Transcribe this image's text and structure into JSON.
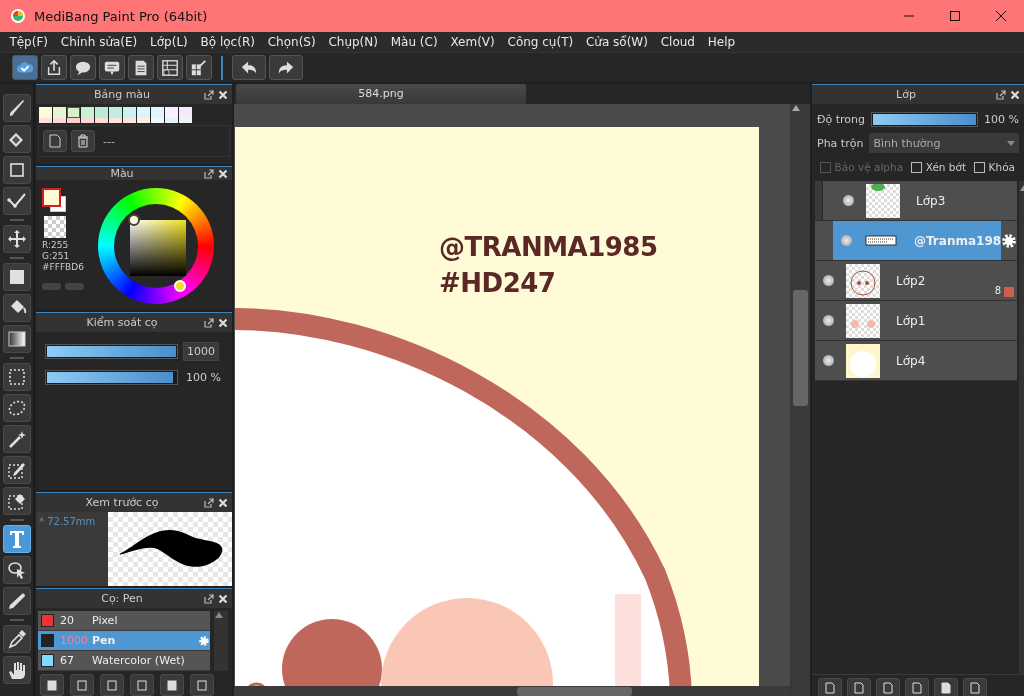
{
  "window": {
    "title": "MediBang Paint Pro (64bit)"
  },
  "menu": [
    "Tệp(F)",
    "Chỉnh sửa(E)",
    "Lớp(L)",
    "Bộ lọc(R)",
    "Chọn(S)",
    "Chụp(N)",
    "Màu (C)",
    "Xem(V)",
    "Công cụ(T)",
    "Cửa sổ(W)",
    "Cloud",
    "Help"
  ],
  "tool_groups": [
    [
      {
        "kind": "brush",
        "selected": false
      },
      {
        "kind": "eraser",
        "selected": false
      },
      {
        "kind": "square",
        "selected": false
      },
      {
        "kind": "polyline",
        "selected": false
      }
    ],
    [
      {
        "kind": "move",
        "selected": false
      }
    ],
    [
      {
        "kind": "fill",
        "selected": false
      },
      {
        "kind": "bucket",
        "selected": false
      },
      {
        "kind": "gradient",
        "selected": false
      }
    ],
    [
      {
        "kind": "select",
        "selected": false
      },
      {
        "kind": "lasso",
        "selected": false
      },
      {
        "kind": "wand",
        "selected": false
      },
      {
        "kind": "selpen",
        "selected": false
      },
      {
        "kind": "seleraser",
        "selected": false
      }
    ],
    [
      {
        "kind": "text",
        "selected": true
      },
      {
        "kind": "pointer",
        "selected": false
      },
      {
        "kind": "blade",
        "selected": false
      }
    ],
    [
      {
        "kind": "dropper",
        "selected": false
      },
      {
        "kind": "hand",
        "selected": false
      }
    ]
  ],
  "palette": {
    "title": "Bảng màu",
    "set_name": "---",
    "rows": [
      [
        {
          "color": "#fffbd6",
          "selected": false
        },
        {
          "color": "#e6f5d2",
          "selected": false
        },
        {
          "color": "#d6f0c8",
          "selected": true
        },
        {
          "color": "#c9efd6",
          "selected": false
        },
        {
          "color": "#b9ecd3",
          "selected": false
        },
        {
          "color": "#bfeee1",
          "selected": false
        },
        {
          "color": "#c9f2f2",
          "selected": false
        },
        {
          "color": "#d8f6fb",
          "selected": false
        },
        {
          "color": "#e1f5fe",
          "selected": false
        },
        {
          "color": "#f6f0ff",
          "selected": false
        },
        {
          "color": "#f6e8ff",
          "selected": false
        }
      ],
      [
        {
          "color": "#ffe0e0",
          "selected": false
        },
        {
          "color": "#ffd8dc",
          "selected": false
        },
        {
          "color": "#ffd0d0",
          "selected": false
        },
        {
          "color": "#ffd6d6",
          "selected": false
        },
        {
          "color": "#ffdcd4",
          "selected": false
        },
        {
          "color": "#ffe2dc",
          "selected": false
        },
        {
          "color": "#ffe6dc",
          "selected": false
        },
        {
          "color": "#fff0e0",
          "selected": false
        },
        {
          "color": "#f0f6ff",
          "selected": false
        },
        {
          "color": "#e6f4f8",
          "selected": false
        },
        {
          "color": "#eef4f2",
          "selected": false
        }
      ]
    ]
  },
  "color_panel": {
    "title": "Màu",
    "r": "R:255",
    "g": "G:251",
    "hex": "#FFFBD6"
  },
  "brush_control": {
    "title": "Kiểm soát cọ",
    "sliders": [
      {
        "level": 1,
        "reading": "1000",
        "boxed": true
      },
      {
        "level": 0.98,
        "reading": "100 %",
        "boxed": false
      }
    ]
  },
  "brush_preview": {
    "title": "Xem trước cọ",
    "size": "* 72.57mm"
  },
  "brushes": {
    "title": "Cọ: Pen",
    "items": [
      {
        "size": "20",
        "name": "Pixel",
        "color": "#ee3333",
        "selected": false
      },
      {
        "size": "1000",
        "name": "Pen",
        "color": "#222222",
        "selected": true
      },
      {
        "size": "67",
        "name": "Watercolor (Wet)",
        "color": "#7fdcff",
        "selected": false
      }
    ]
  },
  "document": {
    "tab": "584.png",
    "canvas_text": [
      "@TRANMA1985",
      "#HD247"
    ]
  },
  "layers": {
    "title": "Lớp",
    "opacity_label": "Độ trong",
    "opacity": {
      "level": 1
    },
    "opacity_reading": "100 %",
    "blend_label": "Pha trộn",
    "blend_value": "Bình thường",
    "checks": [
      {
        "label": "Bảo vệ alpha",
        "checked": false,
        "disabled": true
      },
      {
        "label": "Xén bớt",
        "checked": false,
        "disabled": false
      },
      {
        "label": "Khóa",
        "checked": false,
        "disabled": false
      }
    ],
    "items": [
      {
        "name": "Lớp3",
        "kind": "leaf",
        "selected": false,
        "clipped": true
      },
      {
        "name": "@Tranma198",
        "kind": "text",
        "selected": true,
        "clipped": false
      },
      {
        "name": "Lớp2",
        "kind": "sketch",
        "selected": false,
        "clipped": false,
        "count": "8",
        "color": "#c8604f"
      },
      {
        "name": "Lớp1",
        "kind": "dots",
        "selected": false,
        "clipped": false
      },
      {
        "name": "Lớp4",
        "kind": "cream",
        "selected": false,
        "clipped": false
      }
    ]
  }
}
